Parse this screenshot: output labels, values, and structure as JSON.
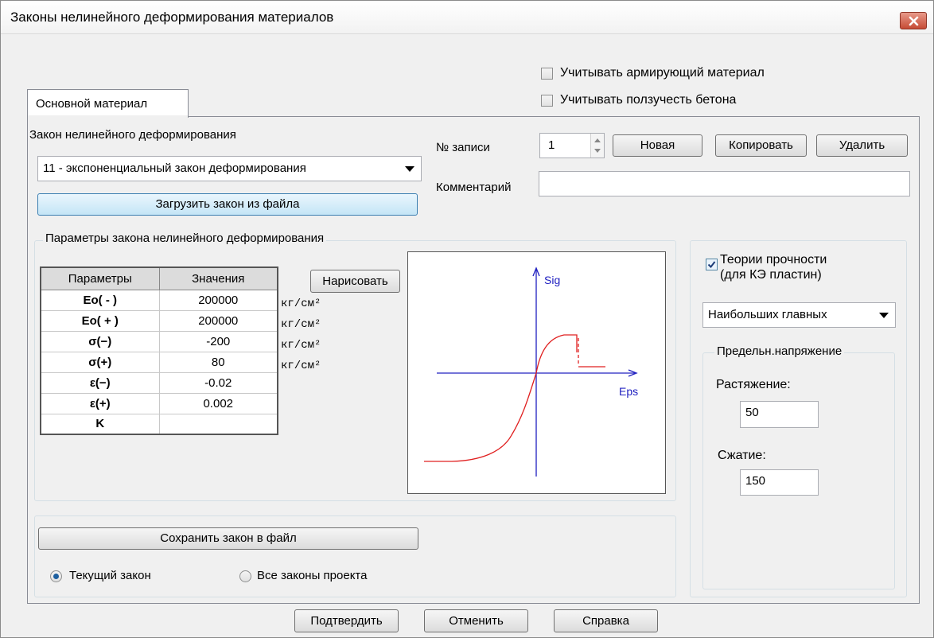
{
  "window": {
    "title": "Законы нелинейного деформирования материалов"
  },
  "options": {
    "reinforcing": {
      "label": "Учитывать армирующий материал",
      "checked": false
    },
    "creep": {
      "label": "Учитывать ползучесть бетона",
      "checked": false
    }
  },
  "tabs": [
    {
      "label": "Основной материал",
      "active": true
    }
  ],
  "law": {
    "group_label": "Закон нелинейного деформирования",
    "selected": "11 - экспоненциальный закон деформирования",
    "load_button": "Загрузить закон из файла"
  },
  "record": {
    "label": "№ записи",
    "number": "1",
    "new_button": "Новая",
    "copy_button": "Копировать",
    "delete_button": "Удалить",
    "comment_label": "Комментарий",
    "comment_value": ""
  },
  "params": {
    "group_label": "Параметры закона нелинейного деформирования",
    "headers": [
      "Параметры",
      "Значения"
    ],
    "rows": [
      {
        "name": "Eo( - )",
        "value": "200000",
        "unit": "кг/см²"
      },
      {
        "name": "Eo( + )",
        "value": "200000",
        "unit": "кг/см²"
      },
      {
        "name": "σ(−)",
        "value": "-200",
        "unit": "кг/см²"
      },
      {
        "name": "σ(+)",
        "value": "80",
        "unit": "кг/см²"
      },
      {
        "name": "ε(−)",
        "value": "-0.02",
        "unit": ""
      },
      {
        "name": "ε(+)",
        "value": "0.002",
        "unit": ""
      },
      {
        "name": "K",
        "value": "",
        "unit": ""
      }
    ],
    "draw_button": "Нарисовать"
  },
  "plot": {
    "y_label": "Sig",
    "x_label": "Eps",
    "curve_color": "#e02020",
    "axis_color": "#2020c0"
  },
  "save": {
    "button": "Сохранить закон в файл",
    "current_label": "Текущий закон",
    "all_label": "Все законы проекта",
    "selected": "current"
  },
  "strength": {
    "label_line1": "Теории прочности",
    "label_line2": "(для КЭ пластин)",
    "checked": true,
    "theory": "Наибольших главных",
    "limit_group": "Предельн.напряжение",
    "tension_label": "Растяжение:",
    "tension_value": "50",
    "compression_label": "Сжатие:",
    "compression_value": "150"
  },
  "footer": {
    "confirm": "Подтвердить",
    "cancel": "Отменить",
    "help": "Справка"
  }
}
